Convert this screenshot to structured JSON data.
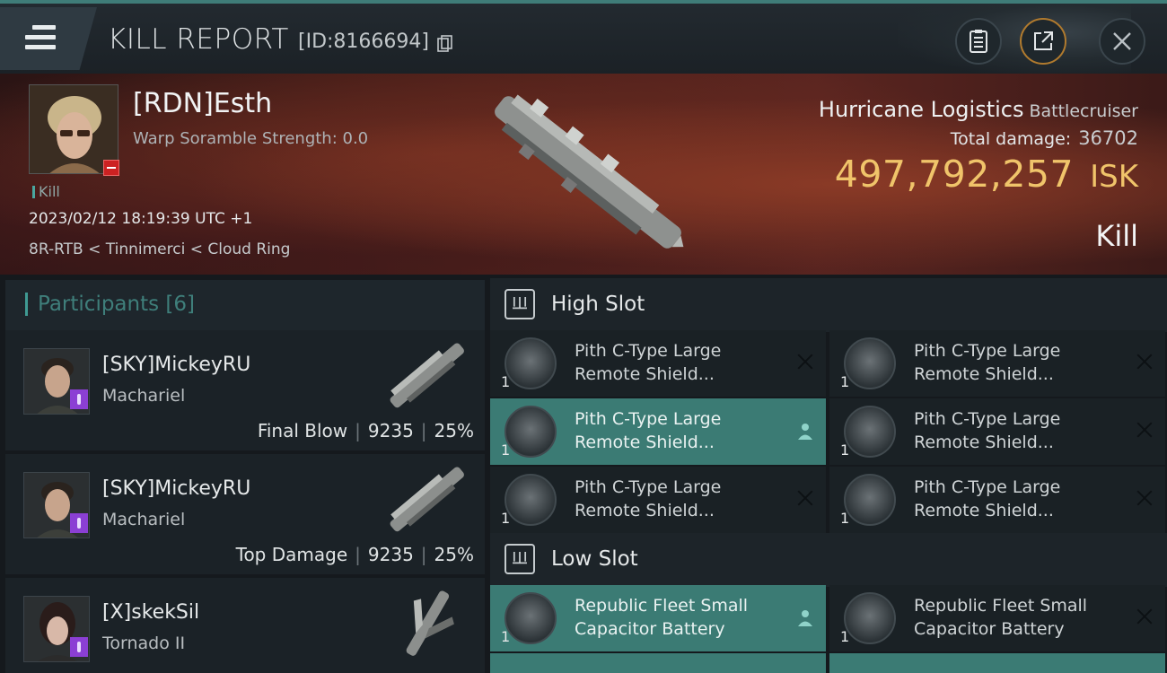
{
  "header": {
    "title": "KILL REPORT",
    "id_label": "[ID:8166694]",
    "icons": {
      "menu": "hamburger-menu-icon",
      "copy": "copy-icon",
      "clipboard": "clipboard-icon",
      "share": "share-icon",
      "close": "close-icon"
    }
  },
  "victim": {
    "name": "[RDN]Esth",
    "scramble": "Warp Soramble Strength: 0.0",
    "kill_tag": "Kill",
    "datetime": "2023/02/12 18:19:39 UTC +1",
    "location": "8R-RTB < Tinnimerci < Cloud Ring",
    "ship": "Hurricane Logistics",
    "ship_class": "Battlecruiser",
    "total_damage_label": "Total damage:",
    "total_damage": "36702",
    "isk_value": "497,792,257",
    "isk_unit": "ISK",
    "result": "Kill"
  },
  "participants": {
    "title": "Participants [6]",
    "items": [
      {
        "name": "[SKY]MickeyRU",
        "ship": "Machariel",
        "role": "Final Blow",
        "damage": "9235",
        "percent": "25%"
      },
      {
        "name": "[SKY]MickeyRU",
        "ship": "Machariel",
        "role": "Top Damage",
        "damage": "9235",
        "percent": "25%"
      },
      {
        "name": "[X]skekSil",
        "ship": "Tornado II",
        "role": "",
        "damage": "",
        "percent": ""
      }
    ]
  },
  "fitting": {
    "high_slot": {
      "title": "High Slot",
      "modules": [
        {
          "line1": "Pith C-Type Large",
          "line2": "Remote Shield...",
          "qty": "1",
          "state": "destroyed"
        },
        {
          "line1": "Pith C-Type Large",
          "line2": "Remote Shield...",
          "qty": "1",
          "state": "destroyed"
        },
        {
          "line1": "Pith C-Type Large",
          "line2": "Remote Shield...",
          "qty": "1",
          "state": "dropped"
        },
        {
          "line1": "Pith C-Type Large",
          "line2": "Remote Shield...",
          "qty": "1",
          "state": "destroyed"
        },
        {
          "line1": "Pith C-Type Large",
          "line2": "Remote Shield...",
          "qty": "1",
          "state": "destroyed"
        },
        {
          "line1": "Pith C-Type Large",
          "line2": "Remote Shield...",
          "qty": "1",
          "state": "destroyed"
        }
      ]
    },
    "low_slot": {
      "title": "Low Slot",
      "modules": [
        {
          "line1": "Republic Fleet Small",
          "line2": "Capacitor Battery",
          "qty": "1",
          "state": "dropped"
        },
        {
          "line1": "Republic Fleet Small",
          "line2": "Capacitor Battery",
          "qty": "1",
          "state": "destroyed"
        }
      ]
    }
  },
  "colors": {
    "accent": "#3f9a93",
    "isk": "#f0c46a",
    "active_row": "#3b7b74",
    "corp_badge": "#8b3fd4",
    "standing_badge": "#cc2222"
  }
}
